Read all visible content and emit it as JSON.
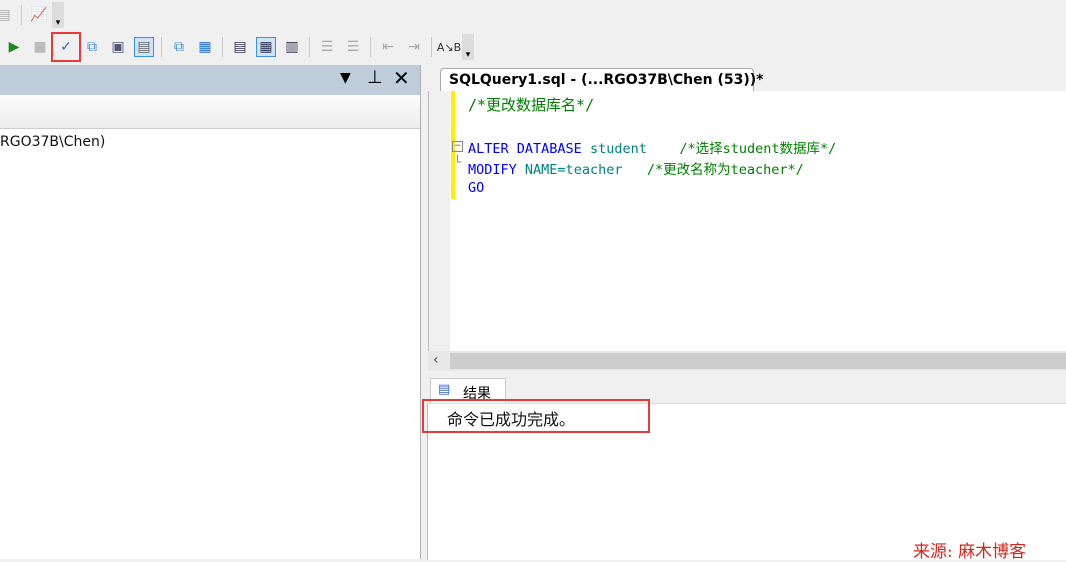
{
  "toolbar": {
    "row1": [
      "print-icon",
      "chart-icon"
    ],
    "row2": [
      "execute-icon",
      "stop-icon",
      "parse-icon",
      "estimated-plan-icon",
      "query-options-icon",
      "results-to-file-icon",
      "display-plan-icon",
      "client-stats-icon",
      "results-to-text-icon",
      "results-to-grid-icon",
      "results-to-file2-icon",
      "comment-icon",
      "uncomment-icon",
      "decrease-indent-icon",
      "increase-indent-icon",
      "specify-values-icon"
    ]
  },
  "left_panel": {
    "tree_item": "RGO37B\\Chen)"
  },
  "editor": {
    "tab_label": "SQLQuery1.sql - (...RGO37B\\Chen (53))*",
    "lines": {
      "l1": "/*更改数据库名*/",
      "l2a": "ALTER",
      "l2b": "DATABASE",
      "l2c": "student",
      "l2d": "/*选择student数据库*/",
      "l3a": "MODIFY",
      "l3b": "NAME=teacher",
      "l3d": "/*更改名称为teacher*/",
      "l4": "GO"
    }
  },
  "results": {
    "tab_label": "结果",
    "message": "命令已成功完成。"
  },
  "watermark": "来源: 麻木博客",
  "colors": {
    "highlight": "#e83a3a",
    "panel_header": "#bfcddb"
  }
}
